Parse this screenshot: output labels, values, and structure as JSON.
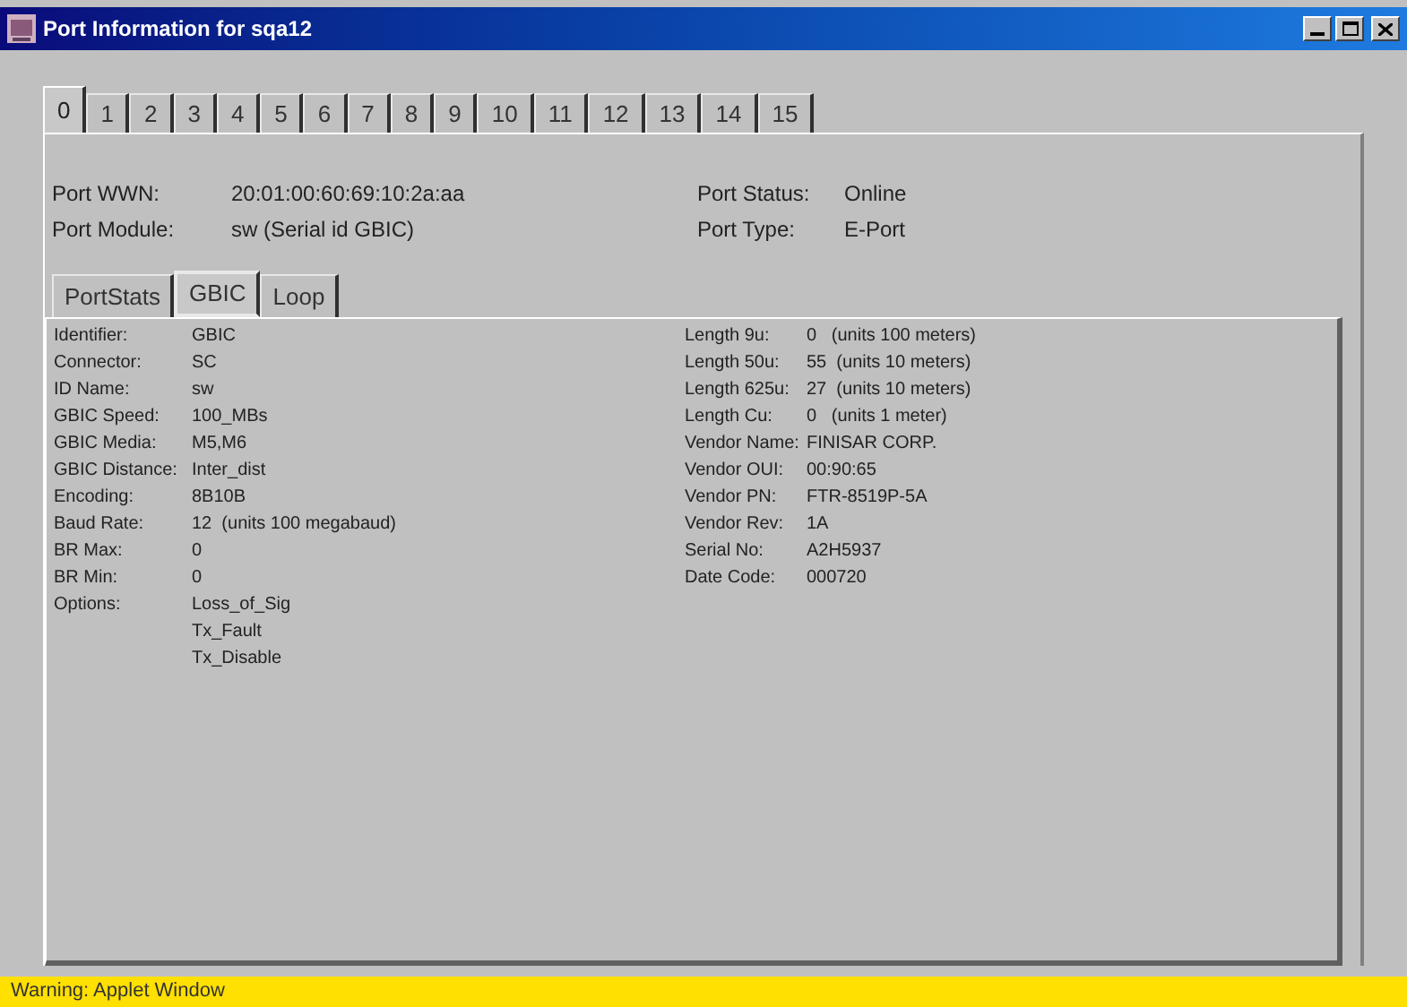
{
  "window": {
    "title": "Port Information for sqa12"
  },
  "port_tabs": [
    {
      "label": "0",
      "selected": true
    },
    {
      "label": "1",
      "selected": false
    },
    {
      "label": "2",
      "selected": false
    },
    {
      "label": "3",
      "selected": false
    },
    {
      "label": "4",
      "selected": false
    },
    {
      "label": "5",
      "selected": false
    },
    {
      "label": "6",
      "selected": false
    },
    {
      "label": "7",
      "selected": false
    },
    {
      "label": "8",
      "selected": false
    },
    {
      "label": "9",
      "selected": false
    },
    {
      "label": "10",
      "selected": false
    },
    {
      "label": "11",
      "selected": false
    },
    {
      "label": "12",
      "selected": false
    },
    {
      "label": "13",
      "selected": false
    },
    {
      "label": "14",
      "selected": false
    },
    {
      "label": "15",
      "selected": false
    }
  ],
  "port_info": {
    "left": [
      {
        "label": "Port WWN:",
        "value": "20:01:00:60:69:10:2a:aa"
      },
      {
        "label": "Port Module:",
        "value": "sw (Serial id GBIC)"
      }
    ],
    "right": [
      {
        "label": "Port Status:",
        "value": "Online"
      },
      {
        "label": "Port Type:",
        "value": "E-Port"
      }
    ]
  },
  "detail_tabs": [
    {
      "label": "PortStats",
      "selected": false
    },
    {
      "label": "GBIC",
      "selected": true
    },
    {
      "label": "Loop",
      "selected": false
    }
  ],
  "gbic_left": [
    {
      "label": "Identifier:",
      "values": [
        "GBIC"
      ]
    },
    {
      "label": "Connector:",
      "values": [
        "SC"
      ]
    },
    {
      "label": "ID Name:",
      "values": [
        "sw"
      ]
    },
    {
      "label": "GBIC Speed:",
      "values": [
        "100_MBs"
      ]
    },
    {
      "label": "GBIC Media:",
      "values": [
        "M5,M6"
      ]
    },
    {
      "label": "GBIC Distance:",
      "values": [
        "Inter_dist"
      ]
    },
    {
      "label": "Encoding:",
      "values": [
        "8B10B"
      ]
    },
    {
      "label": "Baud Rate:",
      "values": [
        "12  (units 100 megabaud)"
      ]
    },
    {
      "label": "BR Max:",
      "values": [
        "0"
      ]
    },
    {
      "label": "BR Min:",
      "values": [
        "0"
      ]
    },
    {
      "label": "Options:",
      "values": [
        "Loss_of_Sig",
        "Tx_Fault",
        "Tx_Disable"
      ]
    }
  ],
  "gbic_right": [
    {
      "label": "Length 9u:",
      "values": [
        "0   (units 100 meters)"
      ]
    },
    {
      "label": "Length 50u:",
      "values": [
        "55  (units 10 meters)"
      ]
    },
    {
      "label": "Length 625u:",
      "values": [
        "27  (units 10 meters)"
      ]
    },
    {
      "label": "Length Cu:",
      "values": [
        "0   (units 1 meter)"
      ]
    },
    {
      "label": "Vendor Name:",
      "values": [
        "FINISAR CORP."
      ]
    },
    {
      "label": "Vendor OUI:",
      "values": [
        "00:90:65"
      ]
    },
    {
      "label": "Vendor PN:",
      "values": [
        "FTR-8519P-5A"
      ]
    },
    {
      "label": "Vendor Rev:",
      "values": [
        "1A"
      ]
    },
    {
      "label": "Serial No:",
      "values": [
        "A2H5937"
      ]
    },
    {
      "label": "Date Code:",
      "values": [
        "000720"
      ]
    }
  ],
  "status_bar": {
    "text": "Warning: Applet Window"
  }
}
